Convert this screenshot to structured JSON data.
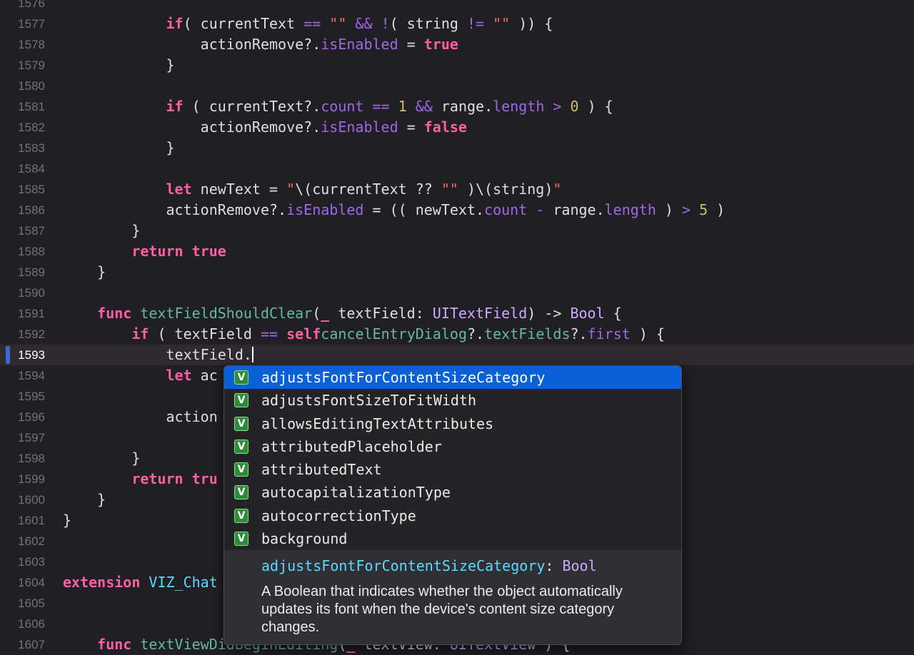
{
  "editor": {
    "current_line": "1593",
    "lines": [
      {
        "num": "1576",
        "tokens": []
      },
      {
        "num": "1577",
        "tokens": [
          [
            "kw",
            "            if"
          ],
          [
            "",
            "( currentText "
          ],
          [
            "op",
            "=="
          ],
          [
            "str",
            " \"\""
          ],
          [
            "",
            " "
          ],
          [
            "op",
            "&&"
          ],
          [
            "",
            " "
          ],
          [
            "op",
            "!"
          ],
          [
            "",
            "( string "
          ],
          [
            "op",
            "!="
          ],
          [
            "str",
            " \"\""
          ],
          [
            "",
            " )) {"
          ]
        ]
      },
      {
        "num": "1578",
        "tokens": [
          [
            "",
            "                actionRemove?."
          ],
          [
            "prop",
            "isEnabled"
          ],
          [
            "",
            " = "
          ],
          [
            "kw",
            "true"
          ]
        ]
      },
      {
        "num": "1579",
        "tokens": [
          [
            "",
            "            }"
          ]
        ]
      },
      {
        "num": "1580",
        "tokens": []
      },
      {
        "num": "1581",
        "tokens": [
          [
            "kw",
            "            if"
          ],
          [
            "",
            " ( currentText?."
          ],
          [
            "prop",
            "count"
          ],
          [
            "",
            " "
          ],
          [
            "op",
            "=="
          ],
          [
            "",
            " "
          ],
          [
            "num",
            "1"
          ],
          [
            "",
            " "
          ],
          [
            "op",
            "&&"
          ],
          [
            "",
            " range."
          ],
          [
            "prop",
            "length"
          ],
          [
            "",
            " "
          ],
          [
            "op",
            ">"
          ],
          [
            "",
            " "
          ],
          [
            "num",
            "0"
          ],
          [
            "",
            " ) {"
          ]
        ]
      },
      {
        "num": "1582",
        "tokens": [
          [
            "",
            "                actionRemove?."
          ],
          [
            "prop",
            "isEnabled"
          ],
          [
            "",
            " = "
          ],
          [
            "kw",
            "false"
          ]
        ]
      },
      {
        "num": "1583",
        "tokens": [
          [
            "",
            "            }"
          ]
        ]
      },
      {
        "num": "1584",
        "tokens": []
      },
      {
        "num": "1585",
        "tokens": [
          [
            "kw",
            "            let"
          ],
          [
            "",
            " newText = "
          ],
          [
            "str",
            "\""
          ],
          [
            "",
            "\\(currentText ?? "
          ],
          [
            "str",
            "\"\""
          ],
          [
            "",
            " )\\(string)"
          ],
          [
            "str",
            "\""
          ]
        ]
      },
      {
        "num": "1586",
        "tokens": [
          [
            "",
            "            actionRemove?."
          ],
          [
            "prop",
            "isEnabled"
          ],
          [
            "",
            " = (( newText."
          ],
          [
            "prop",
            "count"
          ],
          [
            "",
            " "
          ],
          [
            "op",
            "-"
          ],
          [
            "",
            " range."
          ],
          [
            "prop",
            "length"
          ],
          [
            "",
            " ) "
          ],
          [
            "op",
            ">"
          ],
          [
            "",
            " "
          ],
          [
            "num",
            "5"
          ],
          [
            "",
            " )"
          ]
        ]
      },
      {
        "num": "1587",
        "tokens": [
          [
            "",
            "        }"
          ]
        ]
      },
      {
        "num": "1588",
        "tokens": [
          [
            "kw",
            "        return"
          ],
          [
            "",
            " "
          ],
          [
            "kw",
            "true"
          ]
        ]
      },
      {
        "num": "1589",
        "tokens": [
          [
            "",
            "    }"
          ]
        ]
      },
      {
        "num": "1590",
        "tokens": []
      },
      {
        "num": "1591",
        "tokens": [
          [
            "kw",
            "    func"
          ],
          [
            "",
            " "
          ],
          [
            "fn",
            "textFieldShouldClear"
          ],
          [
            "",
            "("
          ],
          [
            "kw",
            "_"
          ],
          [
            "",
            " textField: "
          ],
          [
            "ty",
            "UITextField"
          ],
          [
            "",
            ") -> "
          ],
          [
            "ty",
            "Bool"
          ],
          [
            "",
            " {"
          ]
        ]
      },
      {
        "num": "1592",
        "tokens": [
          [
            "kw",
            "        if"
          ],
          [
            "",
            " ( textField "
          ],
          [
            "op",
            "=="
          ],
          [
            "",
            " "
          ],
          [
            "kw",
            "self"
          ],
          [
            ".",
            ""
          ],
          [
            "fn",
            "cancelEntryDialog"
          ],
          [
            "",
            "?."
          ],
          [
            "fn",
            "textFields"
          ],
          [
            "",
            "?."
          ],
          [
            "prop",
            "first"
          ],
          [
            "",
            " ) {"
          ]
        ]
      },
      {
        "num": "1593",
        "tokens": [
          [
            "",
            "            textField."
          ]
        ]
      },
      {
        "num": "1594",
        "tokens": [
          [
            "kw",
            "            let"
          ],
          [
            "",
            " ac"
          ]
        ]
      },
      {
        "num": "1595",
        "tokens": []
      },
      {
        "num": "1596",
        "tokens": [
          [
            "",
            "            action"
          ]
        ]
      },
      {
        "num": "1597",
        "tokens": []
      },
      {
        "num": "1598",
        "tokens": [
          [
            "",
            "        }"
          ]
        ]
      },
      {
        "num": "1599",
        "tokens": [
          [
            "kw",
            "        return"
          ],
          [
            "",
            " "
          ],
          [
            "kw",
            "tru"
          ]
        ]
      },
      {
        "num": "1600",
        "tokens": [
          [
            "",
            "    }"
          ]
        ]
      },
      {
        "num": "1601",
        "tokens": [
          [
            "",
            "}"
          ]
        ]
      },
      {
        "num": "1602",
        "tokens": []
      },
      {
        "num": "1603",
        "tokens": []
      },
      {
        "num": "1604",
        "tokens": [
          [
            "kw",
            "extension"
          ],
          [
            "",
            " "
          ],
          [
            "tyd",
            "VIZ_Chat"
          ]
        ]
      },
      {
        "num": "1605",
        "tokens": []
      },
      {
        "num": "1606",
        "tokens": []
      },
      {
        "num": "1607",
        "tokens": [
          [
            "kw",
            "    func"
          ],
          [
            "",
            " "
          ],
          [
            "fn",
            "textViewDidBeginEditing"
          ],
          [
            "",
            "("
          ],
          [
            "kw",
            "_"
          ],
          [
            "",
            " textView: "
          ],
          [
            "ty",
            "UITextView"
          ],
          [
            "",
            " ) {"
          ]
        ]
      }
    ]
  },
  "completion": {
    "badge": "V",
    "items": [
      "adjustsFontForContentSizeCategory",
      "adjustsFontSizeToFitWidth",
      "allowsEditingTextAttributes",
      "attributedPlaceholder",
      "attributedText",
      "autocapitalizationType",
      "autocorrectionType",
      "background"
    ],
    "selected_index": 0,
    "doc": {
      "name": "adjustsFontForContentSizeCategory",
      "colon": ": ",
      "type": "Bool",
      "description": "A Boolean that indicates whether the object automatically updates its font when the device's content size category changes."
    }
  }
}
